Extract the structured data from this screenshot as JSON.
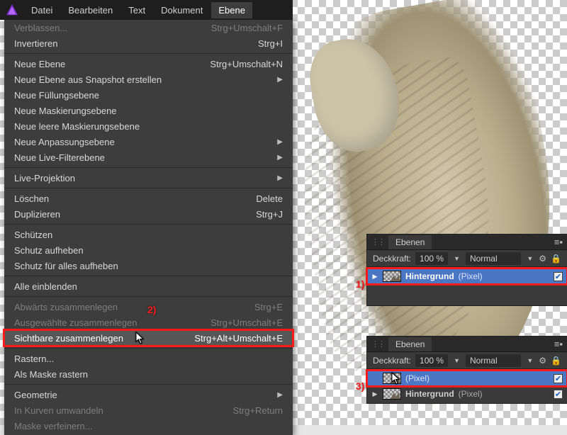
{
  "menubar": {
    "items": [
      "Datei",
      "Bearbeiten",
      "Text",
      "Dokument",
      "Ebene"
    ],
    "open_index": 4
  },
  "menu": [
    {
      "label": "Verblassen...",
      "shortcut": "Strg+Umschalt+F",
      "dim": true
    },
    {
      "label": "Invertieren",
      "shortcut": "Strg+I"
    },
    {
      "sep": true
    },
    {
      "label": "Neue Ebene",
      "shortcut": "Strg+Umschalt+N"
    },
    {
      "label": "Neue Ebene aus Snapshot erstellen",
      "submenu": true
    },
    {
      "label": "Neue Füllungsebene"
    },
    {
      "label": "Neue Maskierungsebene"
    },
    {
      "label": "Neue leere Maskierungsebene"
    },
    {
      "label": "Neue Anpassungsebene",
      "submenu": true
    },
    {
      "label": "Neue Live-Filterebene",
      "submenu": true
    },
    {
      "sep": true
    },
    {
      "label": "Live-Projektion",
      "submenu": true
    },
    {
      "sep": true
    },
    {
      "label": "Löschen",
      "shortcut": "Delete"
    },
    {
      "label": "Duplizieren",
      "shortcut": "Strg+J"
    },
    {
      "sep": true
    },
    {
      "label": "Schützen"
    },
    {
      "label": "Schutz aufheben"
    },
    {
      "label": "Schutz für alles aufheben"
    },
    {
      "sep": true
    },
    {
      "label": "Alle einblenden"
    },
    {
      "sep": true
    },
    {
      "label": "Abwärts zusammenlegen",
      "shortcut": "Strg+E",
      "dim": true
    },
    {
      "label": "Ausgewählte zusammenlegen",
      "shortcut": "Strg+Umschalt+E",
      "dim": true
    },
    {
      "label": "Sichtbare zusammenlegen",
      "shortcut": "Strg+Alt+Umschalt+E",
      "hi": true,
      "cursor": true
    },
    {
      "sep": true
    },
    {
      "label": "Rastern..."
    },
    {
      "label": "Als Maske rastern"
    },
    {
      "sep": true
    },
    {
      "label": "Geometrie",
      "submenu": true
    },
    {
      "label": "In Kurven umwandeln",
      "shortcut": "Strg+Return",
      "dim": true
    },
    {
      "label": "Maske verfeinern...",
      "dim": true
    }
  ],
  "panel_label": {
    "title": "Ebenen",
    "opacity_label": "Deckkraft:",
    "opacity_value": "100 %",
    "blend": "Normal"
  },
  "layer_names": {
    "hintergrund": "Hintergrund",
    "pixel_kind": "(Pixel)"
  },
  "annotations": {
    "a1": "1)",
    "a2": "2)",
    "a3": "3)"
  },
  "colors": {
    "accent": "#ff1a1a",
    "selection": "#4b76c4"
  }
}
